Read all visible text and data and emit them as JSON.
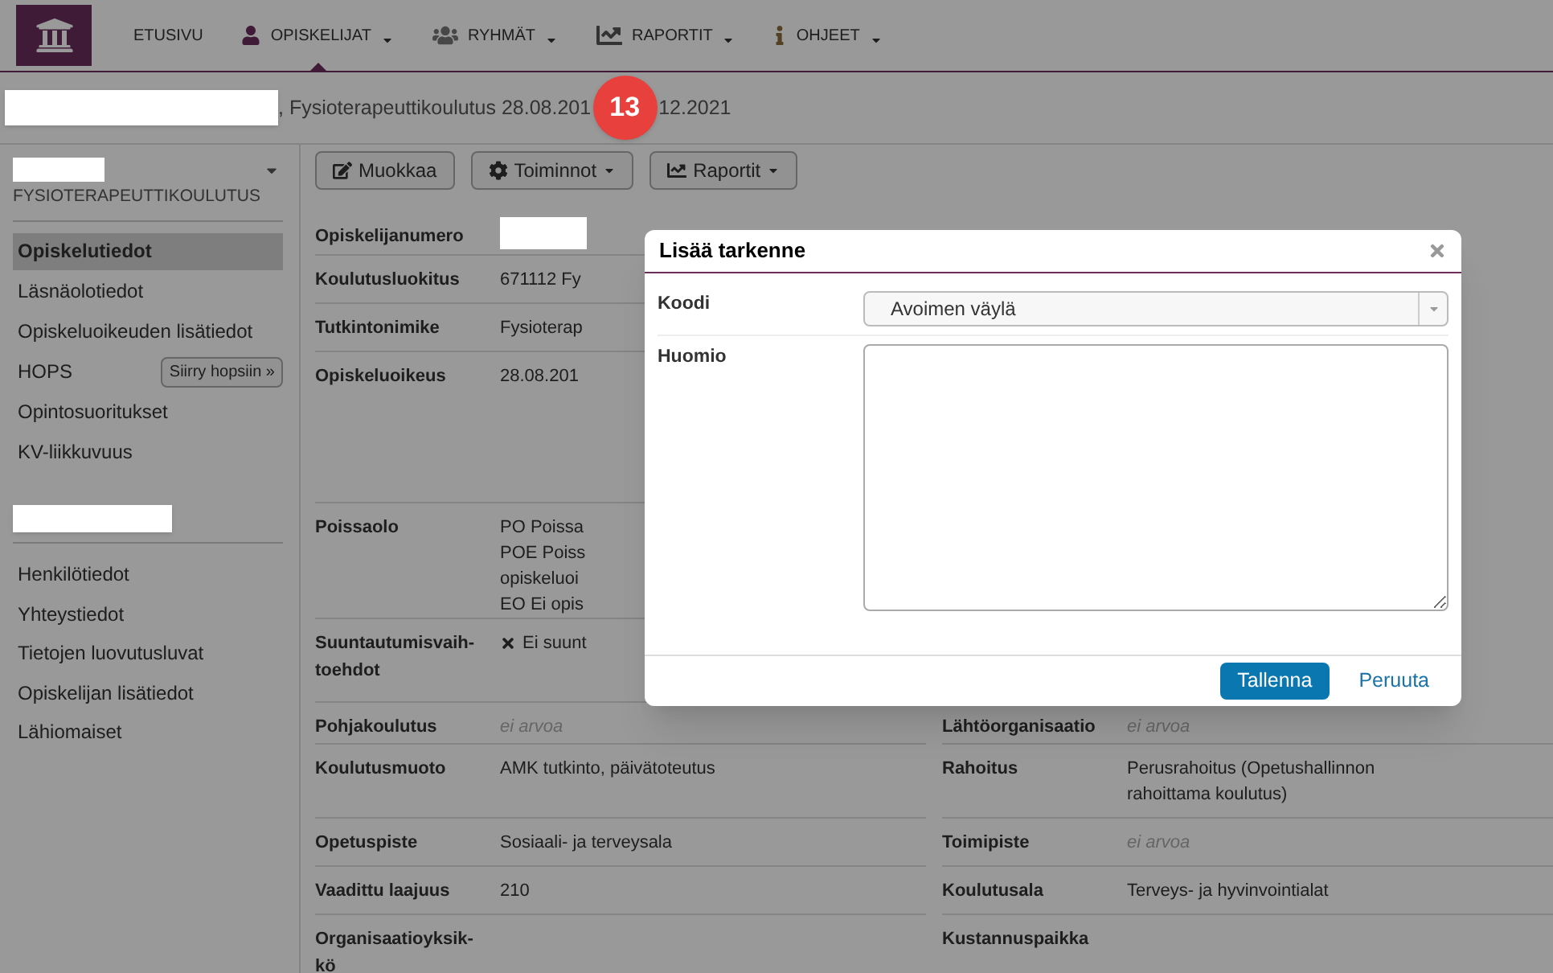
{
  "nav": {
    "items": [
      {
        "label": "ETUSIVU",
        "dropdown": false,
        "selected": false
      },
      {
        "label": "OPISKELIJAT",
        "dropdown": true,
        "selected": true
      },
      {
        "label": "RYHMÄT",
        "dropdown": true,
        "selected": false
      },
      {
        "label": "RAPORTIT",
        "dropdown": true,
        "selected": false
      },
      {
        "label": "OHJEET",
        "dropdown": true,
        "selected": false
      }
    ]
  },
  "header": {
    "title_before": ", Fysioterapeuttikoulutus 28.08.201",
    "title_after": "12.2021",
    "badge": "13"
  },
  "sidebar": {
    "program": "FYSIOTERAPEUTTIKOULUTUS",
    "items": [
      {
        "label": "Opiskelutiedot",
        "selected": true
      },
      {
        "label": "Läsnäolotiedot",
        "selected": false
      },
      {
        "label": "Opiskeluoikeuden lisätiedot",
        "selected": false
      },
      {
        "label": "HOPS",
        "selected": false,
        "button": "Siirry hopsiin »"
      },
      {
        "label": "Opintosuoritukset",
        "selected": false
      },
      {
        "label": "KV-liikkuvuus",
        "selected": false
      }
    ],
    "items2": [
      {
        "label": "Henkilötiedot",
        "selected": false
      },
      {
        "label": "Yhteystiedot",
        "selected": false
      },
      {
        "label": "Tietojen luovutusluvat",
        "selected": false
      },
      {
        "label": "Opiskelijan lisätiedot",
        "selected": false
      },
      {
        "label": "Lähiomaiset",
        "selected": false
      }
    ]
  },
  "toolbar": [
    {
      "label": "Muokkaa",
      "dropdown": false
    },
    {
      "label": "Toiminnot",
      "dropdown": true
    },
    {
      "label": "Raportit",
      "dropdown": true
    }
  ],
  "details": [
    {
      "left": {
        "label": "Opiskelijanumero",
        "redacted": true
      }
    },
    {
      "left": {
        "label": "Koulutusluokitus",
        "lines": [
          "671112 Fy"
        ]
      }
    },
    {
      "left": {
        "label": "Tutkintonimike",
        "lines": [
          "Fysioterap"
        ]
      }
    },
    {
      "left": {
        "label": "Opiskeluoikeus",
        "lines": [
          "28.08.201"
        ]
      }
    },
    {
      "left": {
        "label": "Poissaolo",
        "lines": [
          "PO Poissa",
          "POE Poiss",
          "opiskeluoi",
          "EO Ei opis"
        ]
      }
    },
    {
      "left": {
        "label": "Suuntautumisvaih-toehdot",
        "lines": [
          "Ei suunt"
        ],
        "cross": true
      }
    },
    {
      "left": {
        "label": "Pohjakoulutus",
        "lines": [
          "ei arvoa"
        ],
        "muted": true
      },
      "right": {
        "label": "Lähtöorganisaatio",
        "lines": [
          "ei arvoa"
        ],
        "muted": true
      }
    },
    {
      "left": {
        "label": "Koulutusmuoto",
        "lines": [
          "AMK tutkinto, päivätoteutus"
        ]
      },
      "right": {
        "label": "Rahoitus",
        "lines": [
          "Perusrahoitus (Opetushallinnon",
          "rahoittama koulutus)"
        ]
      }
    },
    {
      "left": {
        "label": "Opetuspiste",
        "lines": [
          "Sosiaali- ja terveysala"
        ]
      },
      "right": {
        "label": "Toimipiste",
        "lines": [
          "ei arvoa"
        ],
        "muted": true
      }
    },
    {
      "left": {
        "label": "Vaadittu laajuus",
        "lines": [
          "210"
        ]
      },
      "right": {
        "label": "Koulutusala",
        "lines": [
          "Terveys- ja hyvinvointialat"
        ]
      }
    },
    {
      "left": {
        "label": "Organisaatioyksik-kö"
      },
      "right": {
        "label": "Kustannuspaikka"
      }
    }
  ],
  "modal": {
    "title": "Lisää tarkenne",
    "fields": [
      {
        "label": "Koodi",
        "kind": "select",
        "value": "Avoimen väylä"
      },
      {
        "label": "Huomio",
        "kind": "textarea"
      }
    ],
    "save": "Tallenna",
    "cancel": "Peruuta"
  }
}
